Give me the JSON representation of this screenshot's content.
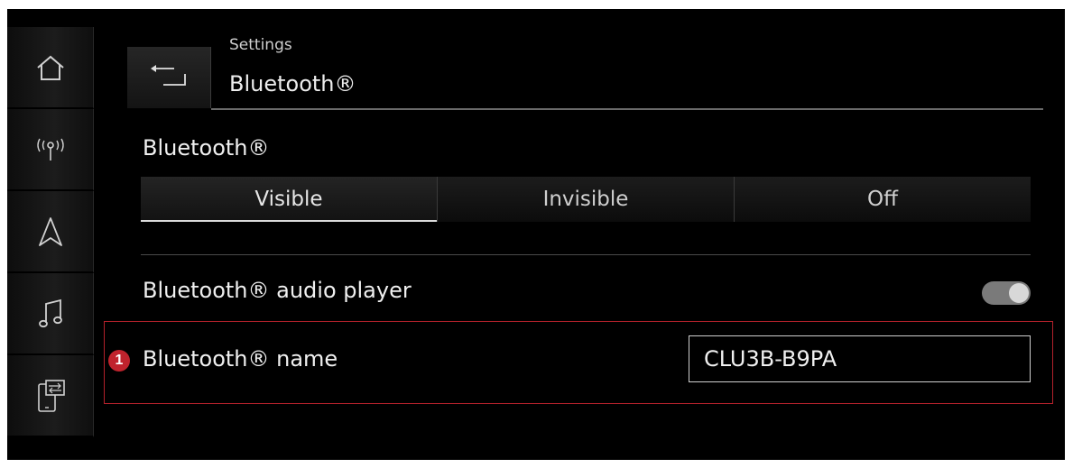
{
  "rail": {
    "items": [
      {
        "icon": "home-icon"
      },
      {
        "icon": "radio-antenna-icon"
      },
      {
        "icon": "navigation-arrow-icon"
      },
      {
        "icon": "music-note-icon"
      },
      {
        "icon": "phone-connect-icon"
      }
    ]
  },
  "header": {
    "breadcrumb": "Settings",
    "title": "Bluetooth®",
    "back_icon": "back-arrow-icon"
  },
  "bluetooth": {
    "section_label": "Bluetooth®",
    "options": [
      "Visible",
      "Invisible",
      "Off"
    ],
    "selected": "Visible"
  },
  "audio_player": {
    "label": "Bluetooth® audio player",
    "toggle_on": true
  },
  "device_name": {
    "callout": "1",
    "label": "Bluetooth® name",
    "value": "CLU3B-B9PA"
  },
  "colors": {
    "highlight": "#b3212b",
    "callout": "#c0232d",
    "background": "#000000"
  }
}
